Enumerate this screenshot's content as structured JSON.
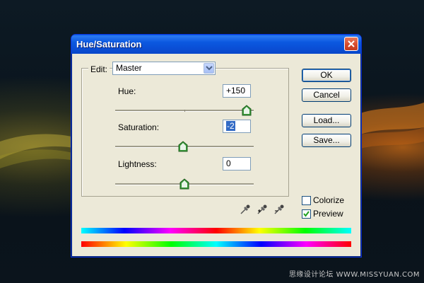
{
  "dialog": {
    "title": "Hue/Saturation",
    "edit_label": "Edit:",
    "edit_value": "Master",
    "hue": {
      "label": "Hue:",
      "value": "+150",
      "slider_fraction": 0.93
    },
    "saturation": {
      "label": "Saturation:",
      "value": "-2",
      "slider_fraction": 0.49
    },
    "lightness": {
      "label": "Lightness:",
      "value": "0",
      "slider_fraction": 0.5
    },
    "buttons": {
      "ok": "OK",
      "cancel": "Cancel",
      "load": "Load...",
      "save": "Save..."
    },
    "colorize": {
      "label": "Colorize",
      "checked": false
    },
    "preview": {
      "label": "Preview",
      "checked": true
    },
    "icons": [
      "close-icon",
      "dropdown-arrow-icon",
      "eyedropper-icon",
      "eyedropper-plus-icon",
      "eyedropper-minus-icon",
      "checkmark-icon"
    ]
  },
  "watermark": "思缘设计论坛 WWW.MISSYUAN.COM"
}
